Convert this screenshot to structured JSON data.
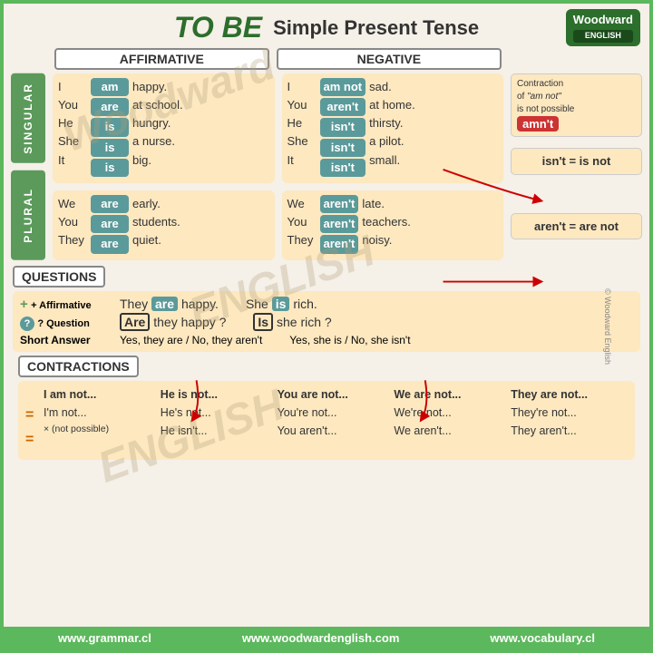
{
  "header": {
    "title_main": "TO BE",
    "title_sub": "Simple Present Tense",
    "logo_name": "Woodward",
    "logo_sub": "ENGLISH"
  },
  "columns": {
    "affirmative": "AFFIRMATIVE",
    "negative": "NEGATIVE"
  },
  "labels": {
    "singular": "SINGULAR",
    "plural": "PLURAL"
  },
  "singular": {
    "affirmative": {
      "subjects": [
        "I",
        "You",
        "He",
        "She",
        "It"
      ],
      "verbs": [
        "am",
        "are",
        "is",
        "is",
        "is"
      ],
      "predicates": [
        "happy.",
        "at school.",
        "hungry.",
        "a nurse.",
        "big."
      ]
    },
    "negative": {
      "subjects": [
        "I",
        "You",
        "He",
        "She",
        "It"
      ],
      "verbs": [
        "am not",
        "aren't",
        "isn't",
        "isn't",
        "isn't"
      ],
      "predicates": [
        "sad.",
        "at home.",
        "thirsty.",
        "a pilot.",
        "small."
      ]
    }
  },
  "plural": {
    "affirmative": {
      "subjects": [
        "We",
        "You",
        "They"
      ],
      "verbs": [
        "are",
        "are",
        "are"
      ],
      "predicates": [
        "early.",
        "students.",
        "quiet."
      ]
    },
    "negative": {
      "subjects": [
        "We",
        "You",
        "They"
      ],
      "verbs": [
        "aren't",
        "aren't",
        "aren't"
      ],
      "predicates": [
        "late.",
        "teachers.",
        "noisy."
      ]
    }
  },
  "callouts": {
    "contraction_note": "Contraction of \"am not\" is not possible",
    "amnt": "amn't",
    "isnt_eq": "isn't = is not",
    "arent_eq": "aren't = are not"
  },
  "questions": {
    "header": "QUESTIONS",
    "affirmative_label": "+ Affirmative",
    "affirmative1": "They",
    "aff_verb1": "are",
    "affirmative1_rest": "happy.",
    "affirmative2": "She",
    "aff_verb2": "is",
    "affirmative2_rest": "rich.",
    "question_label": "? Question",
    "question1_verb": "Are",
    "question1_rest": "they happy ?",
    "question2_verb": "Is",
    "question2_rest": "she rich ?",
    "short_label": "Short Answer",
    "short1": "Yes, they are / No, they aren't",
    "short2": "Yes, she is / No, she isn't"
  },
  "contractions": {
    "header": "CONTRACTIONS",
    "col1": {
      "h": "I am not...",
      "r1": "I'm not...",
      "r2": "× (not possible)",
      "r3": ""
    },
    "col2": {
      "h": "He is not...",
      "r1": "He's not...",
      "r2": "He isn't...",
      "r3": ""
    },
    "col3": {
      "h": "You are not...",
      "r1": "You're not...",
      "r2": "You aren't...",
      "r3": ""
    },
    "col4": {
      "h": "We are not...",
      "r1": "We're not...",
      "r2": "We aren't...",
      "r3": ""
    },
    "col5": {
      "h": "They are not...",
      "r1": "They're not...",
      "r2": "They aren't...",
      "r3": ""
    }
  },
  "footer": {
    "link1": "www.grammar.cl",
    "link2": "www.woodwardenglish.com",
    "link3": "www.vocabulary.cl"
  },
  "copyright": "© Woodward English"
}
